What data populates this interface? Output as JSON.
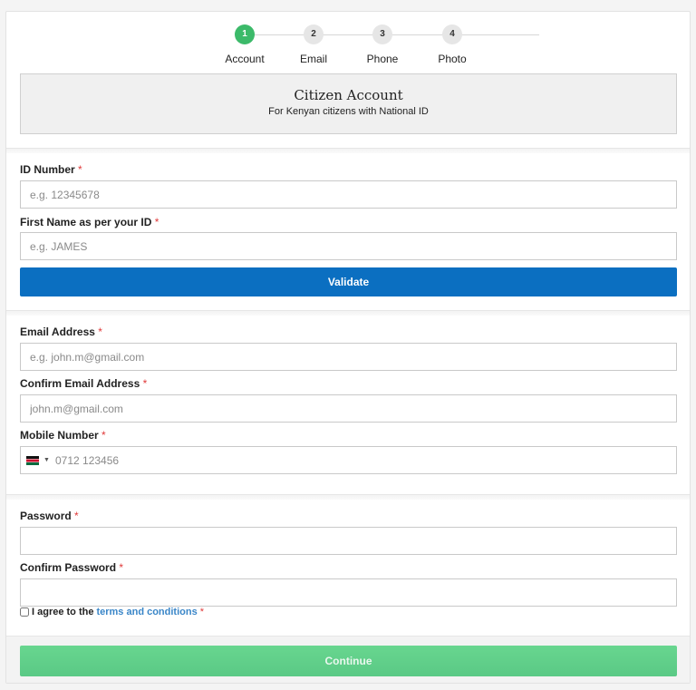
{
  "stepper": {
    "steps": [
      {
        "number": "1",
        "label": "Account"
      },
      {
        "number": "2",
        "label": "Email"
      },
      {
        "number": "3",
        "label": "Phone"
      },
      {
        "number": "4",
        "label": "Photo"
      }
    ],
    "active_step": 1
  },
  "account": {
    "title": "Citizen Account",
    "subtitle": "For Kenyan citizens with National ID"
  },
  "identity": {
    "id_label": "ID Number",
    "id_placeholder": "e.g. 12345678",
    "first_name_label": "First Name as per your ID",
    "first_name_placeholder": "e.g. JAMES",
    "validate_label": "Validate"
  },
  "contact": {
    "email_label": "Email Address",
    "email_placeholder": "e.g. john.m@gmail.com",
    "confirm_email_label": "Confirm Email Address",
    "confirm_email_placeholder": "john.m@gmail.com",
    "mobile_label": "Mobile Number",
    "mobile_placeholder": "0712 123456"
  },
  "security": {
    "password_label": "Password",
    "confirm_password_label": "Confirm Password",
    "agree_text": "I agree to the",
    "terms_link": "terms and conditions"
  },
  "required_mark": "*",
  "footer": {
    "continue_label": "Continue"
  },
  "colors": {
    "step_active": "#3cba6a",
    "validate_button": "#0b6fc1",
    "continue_button": "#5ac985",
    "required": "#e03a3a",
    "link": "#3a86c8"
  }
}
